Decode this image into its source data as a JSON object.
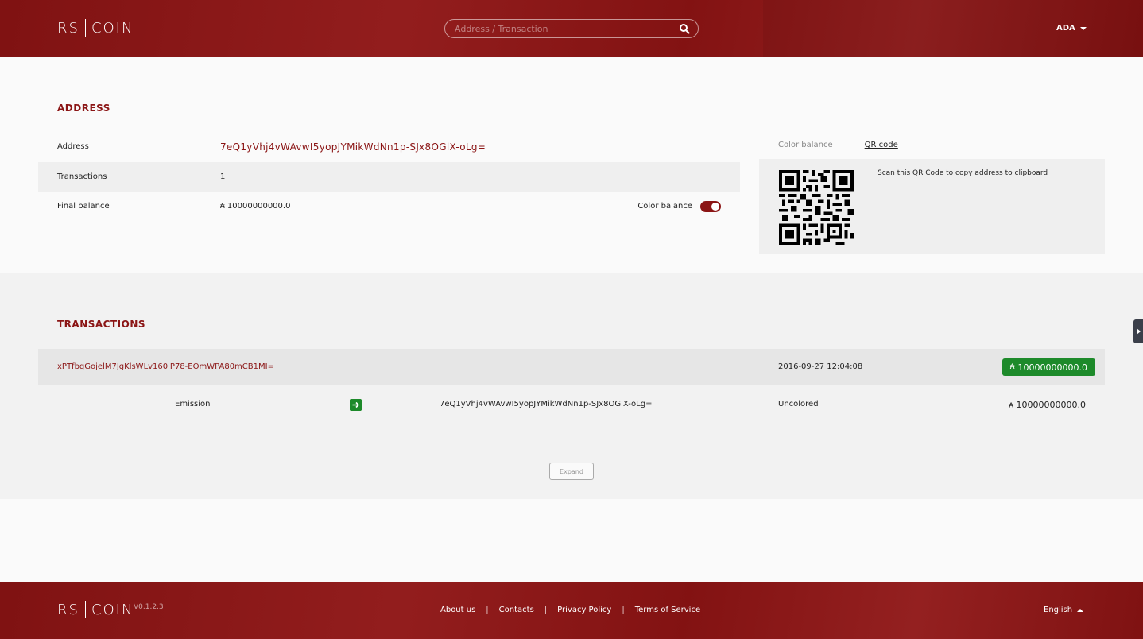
{
  "header": {
    "logo_left": "RS",
    "logo_right": "COIN",
    "search_placeholder": "Address / Transaction",
    "currency": "ADA"
  },
  "address_section": {
    "title": "ADDRESS",
    "rows": {
      "address_label": "Address",
      "address_value": "7eQ1yVhj4vWAvwI5yopJYMikWdNn1p-SJx8OGlX-oLg=",
      "transactions_label": "Transactions",
      "transactions_value": "1",
      "final_balance_label": "Final balance",
      "final_balance_symbol": "₳",
      "final_balance_value": "10000000000.0",
      "color_balance_label": "Color balance"
    },
    "toggle_on": true
  },
  "qr": {
    "tab_color_balance": "Color balance",
    "tab_qr_code": "QR code",
    "instructions": "Scan this QR Code to copy address to clipboard"
  },
  "transactions_section": {
    "title": "TRANSACTIONS",
    "tx": {
      "hash": "xPTfbgGojelM7JgKlsWLv160lP78-EOmWPA80mCB1MI=",
      "date": "2016-09-27 12:04:08",
      "amount_symbol": "₳",
      "amount": "10000000000.0",
      "input_source": "Emission",
      "output_address": "7eQ1yVhj4vWAvwI5yopJYMikWdNn1p-SJx8OGlX-oLg=",
      "output_color": "Uncolored",
      "output_amount": "10000000000.0"
    },
    "expand_label": "Expand"
  },
  "footer": {
    "logo_left": "RS",
    "logo_right": "COIN",
    "version": "V0.1.2.3",
    "links": [
      "About us",
      "Contacts",
      "Privacy Policy",
      "Terms of Service"
    ],
    "language": "English"
  },
  "colors": {
    "brand_red": "#8e1414",
    "accent_red": "#8b1515",
    "success_green": "#1d8a2a"
  },
  "icons": [
    "search-icon",
    "chevron-down-icon",
    "chevron-up-icon",
    "arrow-right-icon",
    "ada-symbol-icon",
    "sidebar-toggle-icon"
  ]
}
